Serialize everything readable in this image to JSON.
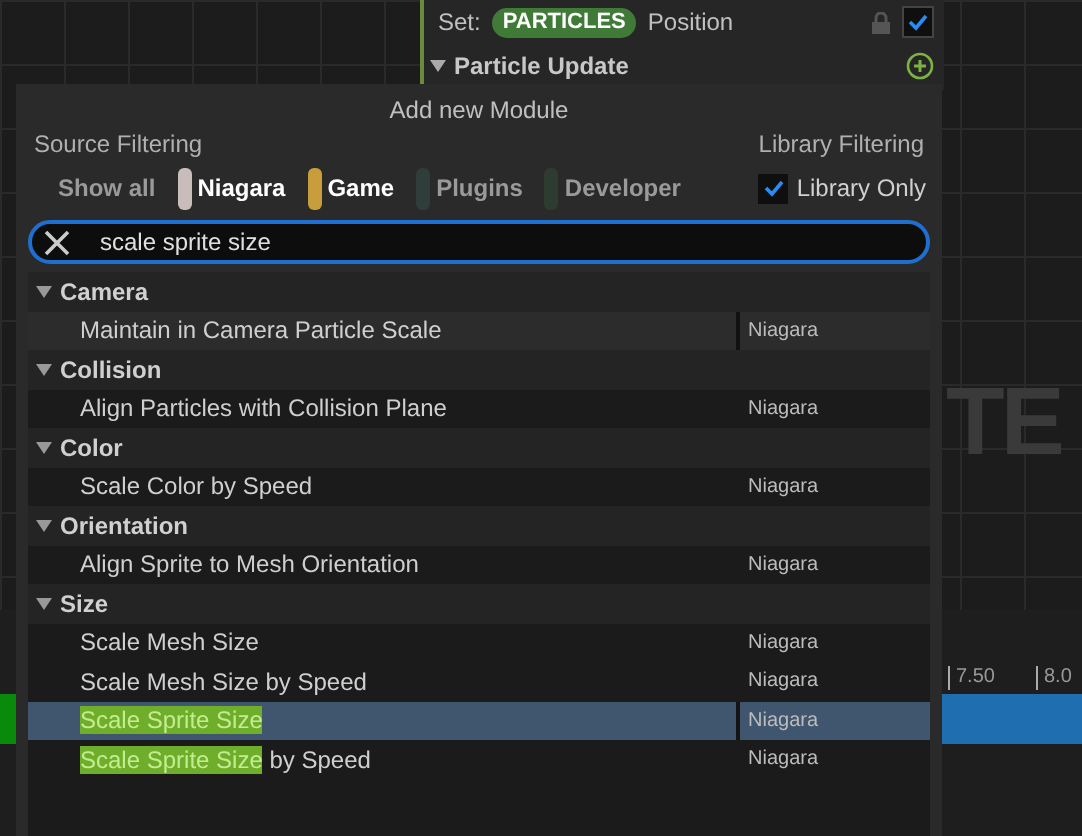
{
  "background": {
    "set_label": "Set:",
    "namespace_pill": "PARTICLES",
    "attribute": "Position",
    "enabled": true,
    "section": "Particle Update",
    "canvas_text": "TE",
    "timeline_ticks": [
      "7.50",
      "8.0"
    ]
  },
  "dialog": {
    "title": "Add new Module",
    "source_filtering": "Source Filtering",
    "library_filtering": "Library Filtering",
    "filters": [
      {
        "label": "Show all",
        "selected": false
      },
      {
        "label": "Niagara",
        "selected": true,
        "color": "#c9bdbb"
      },
      {
        "label": "Game",
        "selected": true,
        "color": "#c89d3c"
      },
      {
        "label": "Plugins",
        "selected": false,
        "color": "#2f3d3b"
      },
      {
        "label": "Developer",
        "selected": false,
        "color": "#2e3b31"
      }
    ],
    "library_only": {
      "label": "Library Only",
      "checked": true
    },
    "search": {
      "value": "scale sprite size"
    },
    "categories": [
      {
        "label": "Camera",
        "expanded": true,
        "items": [
          {
            "text": "Maintain in Camera Particle Scale",
            "source": "Niagara",
            "hovered": true,
            "selected": false
          }
        ]
      },
      {
        "label": "Collision",
        "expanded": true,
        "items": [
          {
            "text": "Align Particles with Collision Plane",
            "source": "Niagara",
            "hovered": false,
            "selected": false
          }
        ]
      },
      {
        "label": "Color",
        "expanded": true,
        "items": [
          {
            "text": "Scale Color by Speed",
            "source": "Niagara",
            "hovered": false,
            "selected": false
          }
        ]
      },
      {
        "label": "Orientation",
        "expanded": true,
        "items": [
          {
            "text": "Align Sprite to Mesh Orientation",
            "source": "Niagara",
            "hovered": false,
            "selected": false
          }
        ]
      },
      {
        "label": "Size",
        "expanded": true,
        "items": [
          {
            "text": "Scale Mesh Size",
            "source": "Niagara",
            "hovered": false,
            "selected": false
          },
          {
            "text": "Scale Mesh Size by Speed",
            "source": "Niagara",
            "hovered": false,
            "selected": false
          },
          {
            "match": "Scale Sprite Size",
            "source": "Niagara",
            "hovered": false,
            "selected": true
          },
          {
            "match": "Scale Sprite Size",
            "text": " by Speed",
            "source": "Niagara",
            "hovered": false,
            "selected": false
          }
        ]
      }
    ]
  }
}
